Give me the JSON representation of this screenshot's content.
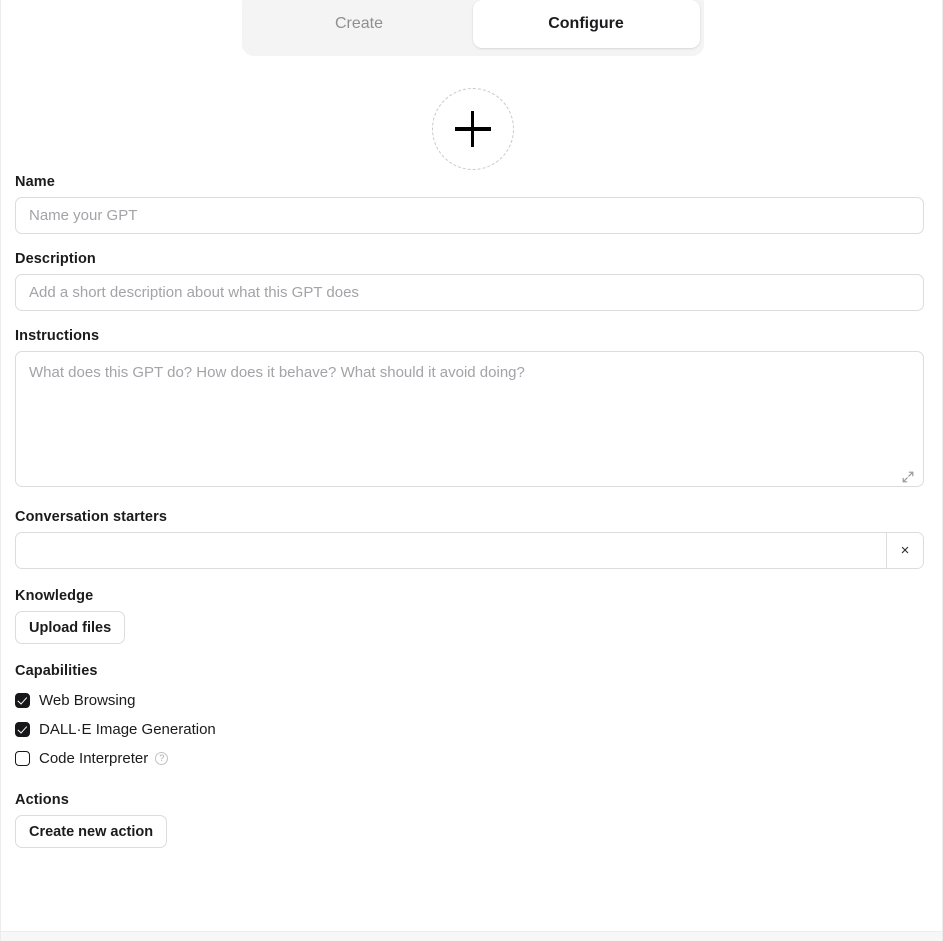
{
  "tabs": [
    {
      "label": "Create",
      "active": false
    },
    {
      "label": "Configure",
      "active": true
    }
  ],
  "avatar": {
    "icon": "plus-icon",
    "aria_label": "Add GPT profile picture"
  },
  "fields": {
    "name": {
      "label": "Name",
      "placeholder": "Name your GPT",
      "value": ""
    },
    "description": {
      "label": "Description",
      "placeholder": "Add a short description about what this GPT does",
      "value": ""
    },
    "instructions": {
      "label": "Instructions",
      "placeholder": "What does this GPT do? How does it behave? What should it avoid doing?",
      "value": "",
      "expand_icon": "expand-diagonal-icon"
    },
    "conversation_starters": {
      "label": "Conversation starters",
      "placeholder": "",
      "value": "",
      "remove_label": "×"
    }
  },
  "knowledge": {
    "label": "Knowledge",
    "upload_button": "Upload files"
  },
  "capabilities": {
    "label": "Capabilities",
    "items": [
      {
        "label": "Web Browsing",
        "checked": true,
        "help": false
      },
      {
        "label": "DALL·E Image Generation",
        "checked": true,
        "help": false
      },
      {
        "label": "Code Interpreter",
        "checked": false,
        "help": true,
        "help_glyph": "?"
      }
    ]
  },
  "actions": {
    "label": "Actions",
    "create_button": "Create new action"
  },
  "colors": {
    "accent": "#17171a",
    "tab_bar_bg": "#f4f4f5",
    "border": "#dcdcdf",
    "placeholder": "#a3a3a8",
    "muted_text": "#8f8f92"
  }
}
